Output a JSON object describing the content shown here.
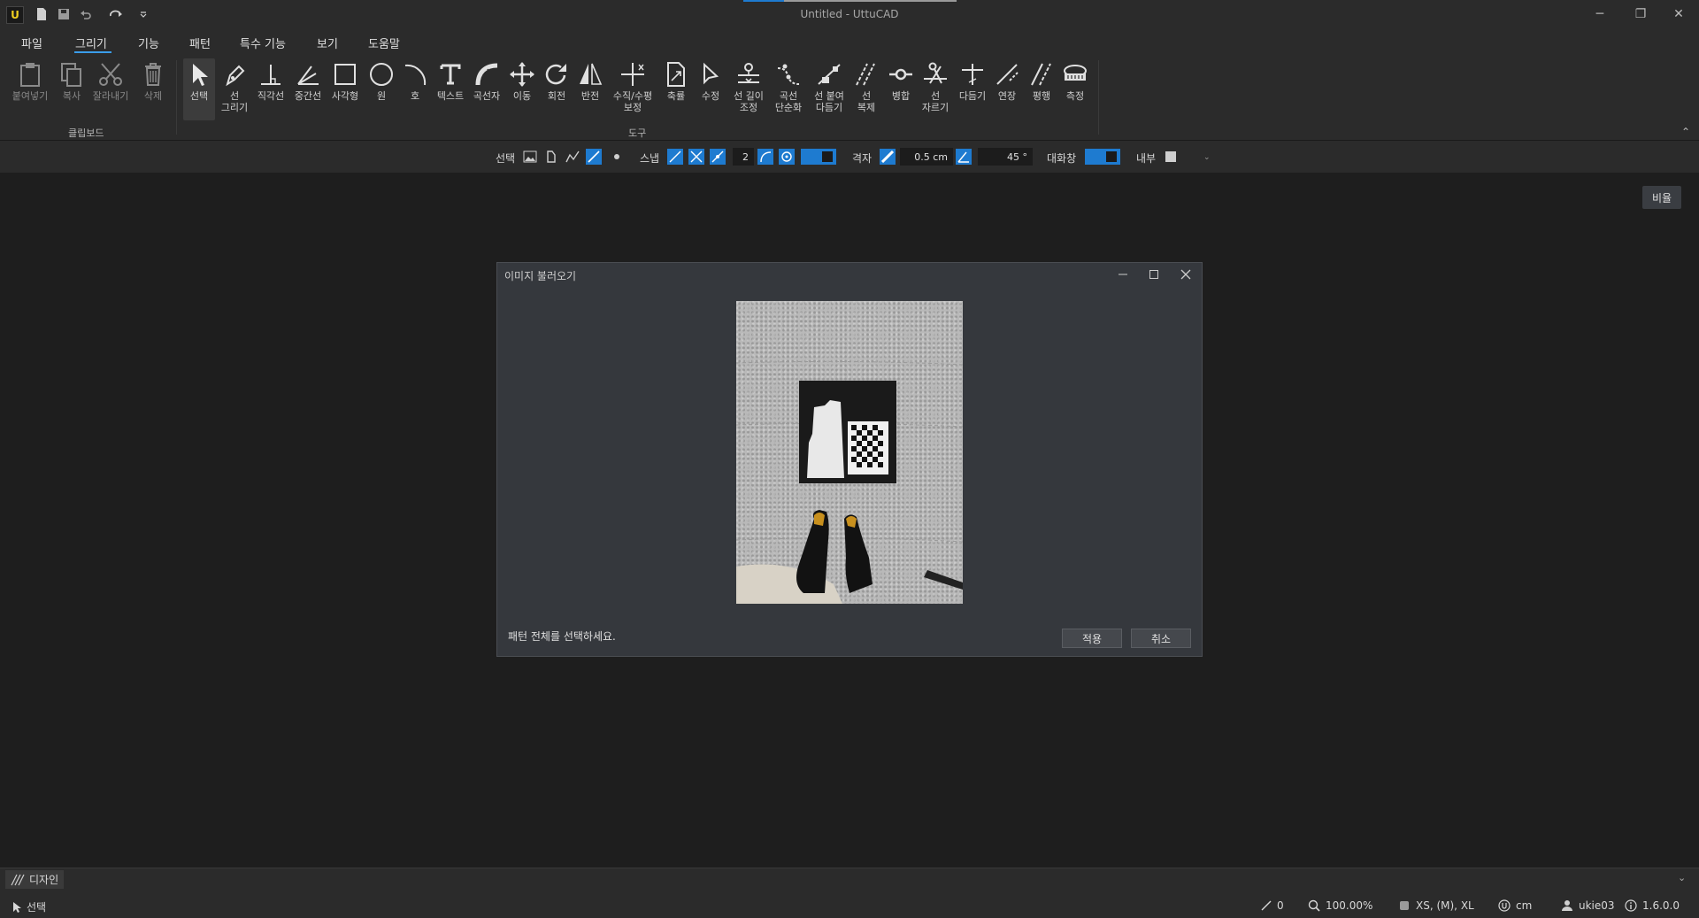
{
  "window": {
    "title": "Untitled - UttuCAD",
    "logo_letter": "U",
    "controls": {
      "minimize": "─",
      "restore": "❐",
      "close": "✕"
    }
  },
  "menu": [
    "파일",
    "그리기",
    "기능",
    "패턴",
    "특수 기능",
    "보기",
    "도움말"
  ],
  "ribbon": {
    "clipboard": {
      "label": "클립보드",
      "tools": [
        {
          "label": "붙여넣기",
          "icon": "paste-icon"
        },
        {
          "label": "복사",
          "icon": "copy-icon"
        },
        {
          "label": "잘라내기",
          "icon": "scissors-icon"
        },
        {
          "label": "삭제",
          "icon": "trash-icon"
        }
      ]
    },
    "tools_group": {
      "label": "도구",
      "tools": [
        {
          "label": "선택",
          "icon": "pointer-icon"
        },
        {
          "label": "선\n그리기",
          "icon": "pen-icon"
        },
        {
          "label": "직각선",
          "icon": "perpendicular-icon"
        },
        {
          "label": "중간선",
          "icon": "bisector-icon"
        },
        {
          "label": "사각형",
          "icon": "rectangle-icon"
        },
        {
          "label": "원",
          "icon": "circle-icon"
        },
        {
          "label": "호",
          "icon": "arc-icon"
        },
        {
          "label": "텍스트",
          "icon": "text-icon"
        },
        {
          "label": "곡선자",
          "icon": "curve-ruler-icon"
        },
        {
          "label": "이동",
          "icon": "move-icon"
        },
        {
          "label": "회전",
          "icon": "rotate-icon"
        },
        {
          "label": "반전",
          "icon": "mirror-icon"
        },
        {
          "label": "수직/수평\n보정",
          "icon": "align-icon"
        },
        {
          "label": "축률",
          "icon": "scale-icon"
        },
        {
          "label": "수정",
          "icon": "edit-icon"
        },
        {
          "label": "선 길이\n조정",
          "icon": "line-length-icon"
        },
        {
          "label": "곡선\n단순화",
          "icon": "simplify-curve-icon"
        },
        {
          "label": "선 붙여\n다듬기",
          "icon": "attach-line-icon"
        },
        {
          "label": "선\n복제",
          "icon": "duplicate-line-icon"
        },
        {
          "label": "병합",
          "icon": "merge-icon"
        },
        {
          "label": "선\n자르기",
          "icon": "cut-line-icon"
        },
        {
          "label": "다듬기",
          "icon": "trim-icon"
        },
        {
          "label": "연장",
          "icon": "extend-icon"
        },
        {
          "label": "평행",
          "icon": "parallel-icon"
        },
        {
          "label": "측정",
          "icon": "tape-measure-icon"
        }
      ]
    }
  },
  "options": {
    "select_label": "선택",
    "snap_label": "스냅",
    "snap_value": "2",
    "grid_label": "격자",
    "grid_value": "0.5 cm",
    "angle_value": "45 °",
    "dialog_label": "대화창",
    "inner_label": "내부"
  },
  "canvas": {
    "ratio_button": "비율"
  },
  "dialog": {
    "title": "이미지 불러오기",
    "message": "패턴 전체를 선택하세요.",
    "apply": "적용",
    "cancel": "취소"
  },
  "design_tab": "디자인",
  "status": {
    "mode": "선택",
    "line_count": "0",
    "zoom": "100.00%",
    "sizes": "XS, (M), XL",
    "unit": "cm",
    "user": "ukie03",
    "version": "1.6.0.0"
  },
  "colors": {
    "accent": "#1e7bd0",
    "background": "#1e1e1e",
    "panel": "#2b2b2b",
    "dialog": "#35383d"
  }
}
